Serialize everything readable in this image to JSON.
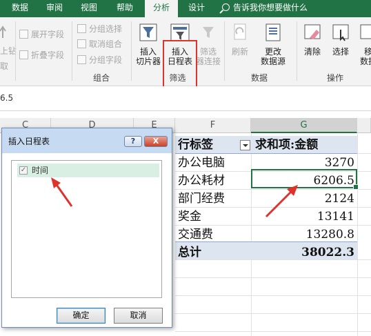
{
  "ribbon_tabs": [
    "数据",
    "审阅",
    "视图",
    "帮助",
    "分析",
    "设计"
  ],
  "tell_me": "告诉我你想要做什么",
  "ribbon": {
    "left_partial": [
      "上钻",
      "取"
    ],
    "group_items": [
      "展开字段",
      "折叠字段",
      "分组选择",
      "取消组合",
      "分组字段"
    ],
    "group_label": "组合",
    "slicer_label": "插入\n切片器",
    "timeline_label": "插入\n日程表",
    "filter_conn_label": "筛选\n器连接",
    "filter_group": "筛选",
    "refresh_label": "刷新",
    "change_source_label": "更改\n数据源",
    "data_group": "数据",
    "clear_label": "清除",
    "select_label": "选择",
    "move_label": "移\n数据",
    "actions_group": "操作"
  },
  "formula_bar_value": "6.5",
  "columns": [
    "C",
    "D",
    "E",
    "F",
    "G"
  ],
  "pivot": {
    "header_label": "行标签",
    "header_value": "求和项:金额",
    "rows": [
      {
        "label": "办公电脑",
        "value": "3270"
      },
      {
        "label": "办公耗材",
        "value": "6206.5"
      },
      {
        "label": "部门经费",
        "value": "2124"
      },
      {
        "label": "奖金",
        "value": "13141"
      },
      {
        "label": "交通费",
        "value": "13280.8"
      }
    ],
    "total_label": "总计",
    "total_value": "38022.3"
  },
  "dialog": {
    "title": "插入日程表",
    "help": "?",
    "close": "X",
    "item_label": "时间",
    "item_checked": "✓",
    "ok_label": "确定",
    "cancel_label": "取消"
  },
  "colors": {
    "excel_green": "#217346",
    "annotation_red": "#e0312b",
    "pivot_header_fill": "#dde5f1"
  }
}
